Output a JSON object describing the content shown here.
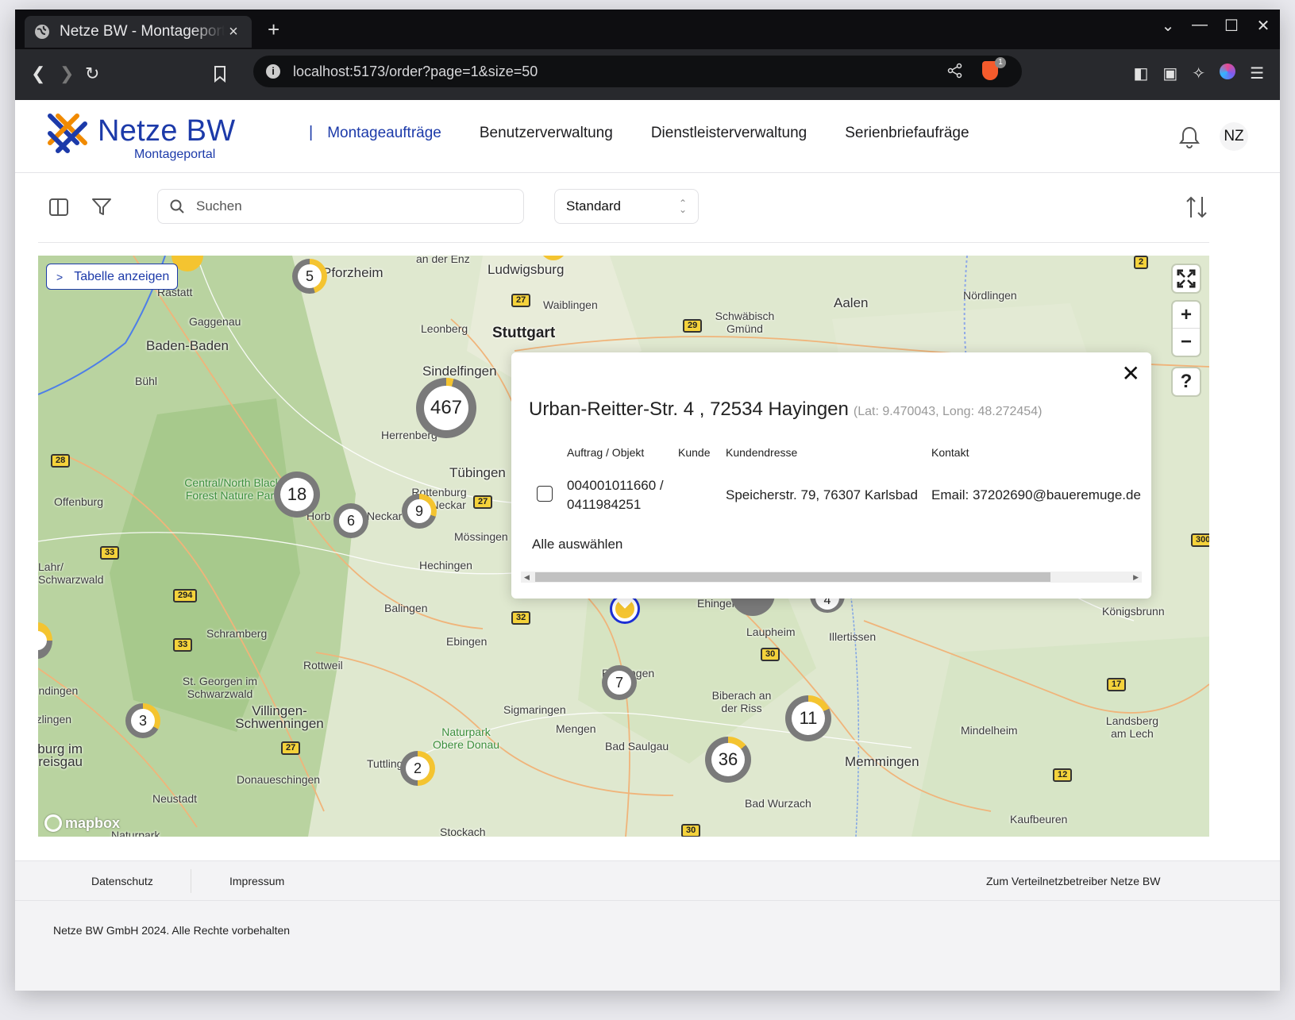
{
  "browser": {
    "tab_title": "Netze BW - Montageportal",
    "tab_close": "×",
    "new_tab": "+",
    "url": "localhost:5173/order?page=1&size=50",
    "shield_badge": "1"
  },
  "header": {
    "logo_text": "Netze BW",
    "logo_sub": "Montageportal",
    "nav": [
      {
        "label": "Montageaufträge",
        "active": true
      },
      {
        "label": "Benutzerverwaltung"
      },
      {
        "label": "Dienstleisterverwaltung"
      },
      {
        "label": "Serienbriefaufräge"
      }
    ],
    "avatar_initials": "NZ"
  },
  "toolbar": {
    "search_placeholder": "Suchen",
    "view_select": "Standard"
  },
  "map": {
    "show_table_label": "Tabelle anzeigen",
    "zoom_in": "+",
    "zoom_out": "−",
    "help": "?",
    "attribution": "mapbox",
    "clusters": [
      {
        "count": "5"
      },
      {
        "count": "467"
      },
      {
        "count": "18"
      },
      {
        "count": "6"
      },
      {
        "count": "9"
      },
      {
        "count": "7"
      },
      {
        "count": "3"
      },
      {
        "count": "2"
      },
      {
        "count": "36"
      },
      {
        "count": "11"
      },
      {
        "count": "4"
      }
    ],
    "places": [
      "an der Enz",
      "Pforzheim",
      "Ludwigsburg",
      "Waiblingen",
      "Rastatt",
      "Gaggenau",
      "Leonberg",
      "Stuttgart",
      "Schwäbisch Gmünd",
      "Aalen",
      "Nördlingen",
      "Baden-Baden",
      "Sindelfingen",
      "Bühl",
      "Herrenberg",
      "Tübingen",
      "Central/North Black Forest Nature Park",
      "Offenburg",
      "Rottenburg am Neckar",
      "Horb",
      "Neckar",
      "Mössingen",
      "Hechingen",
      "Lahr/ Schwarzwald",
      "Balingen",
      "Schramberg",
      "Ebingen",
      "Rottweil",
      "St. Georgen im Schwarzwald",
      "Villingen-Schwenningen",
      "Emmendingen",
      "Denzlingen",
      "Freiburg im Breisgau",
      "Naturpark Obere Donau",
      "Sigmaringen",
      "Mengen",
      "Riedlingen",
      "Bad Saulgau",
      "Tuttlingen",
      "Donaueschingen",
      "Neustadt",
      "Stockach",
      "Ehingen",
      "Laupheim",
      "Illertissen",
      "Biberach an der Riss",
      "Memmingen",
      "Mindelheim",
      "Königsbrunn",
      "Landsberg am Lech",
      "Bad Wurzach",
      "Kaufbeuren",
      "Naturpark"
    ],
    "road_numbers": [
      "27",
      "29",
      "2",
      "28",
      "33",
      "294",
      "33",
      "32",
      "27",
      "27",
      "30",
      "17",
      "12",
      "30",
      "300"
    ]
  },
  "popup": {
    "close": "✕",
    "address": "Urban-Reitter-Str. 4 , 72534 Hayingen",
    "coords": "(Lat: 9.470043, Long: 48.272454)",
    "columns": [
      "Auftrag / Objekt",
      "Kunde",
      "Kundendresse",
      "Kontakt"
    ],
    "rows": [
      {
        "order_line1": "004001011660 /",
        "order_line2": "0411984251",
        "customer": "",
        "customer_address": "Speicherstr. 79, 76307 Karlsbad",
        "contact": "Email: 37202690@baueremuge.de"
      }
    ],
    "select_all": "Alle auswählen"
  },
  "footer": {
    "privacy": "Datenschutz",
    "imprint": "Impressum",
    "operator_link": "Zum Verteilnetzbetreiber Netze BW",
    "copyright": "Netze BW GmbH 2024. Alle Rechte vorbehalten"
  }
}
